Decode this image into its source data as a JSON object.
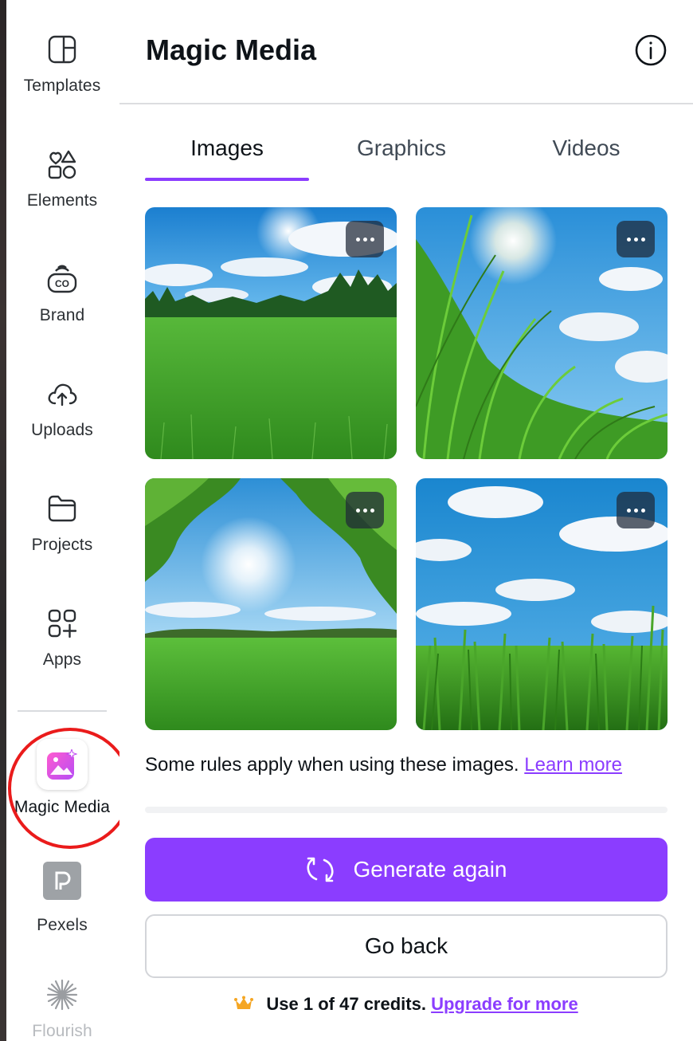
{
  "sidebar": {
    "items": [
      {
        "label": "Templates",
        "icon": "templates-icon"
      },
      {
        "label": "Elements",
        "icon": "elements-icon"
      },
      {
        "label": "Brand",
        "icon": "brand-icon"
      },
      {
        "label": "Uploads",
        "icon": "uploads-icon"
      },
      {
        "label": "Projects",
        "icon": "folder-icon"
      },
      {
        "label": "Apps",
        "icon": "apps-icon"
      },
      {
        "label": "Magic Media",
        "icon": "magic-media-icon"
      },
      {
        "label": "Pexels",
        "icon": "pexels-icon"
      },
      {
        "label": "Flourish",
        "icon": "flourish-icon"
      }
    ]
  },
  "panel": {
    "title": "Magic Media",
    "tabs": [
      {
        "label": "Images",
        "active": true
      },
      {
        "label": "Graphics",
        "active": false
      },
      {
        "label": "Videos",
        "active": false
      }
    ],
    "rules_text": "Some rules apply when using these images.",
    "learn_more": "Learn more",
    "generate_label": "Generate again",
    "back_label": "Go back",
    "credits_text": "Use 1 of 47 credits.",
    "upgrade_link": "Upgrade for more"
  },
  "colors": {
    "accent": "#8b3dff",
    "highlight_ring": "#ea1b1b",
    "crown": "#f5a623"
  }
}
